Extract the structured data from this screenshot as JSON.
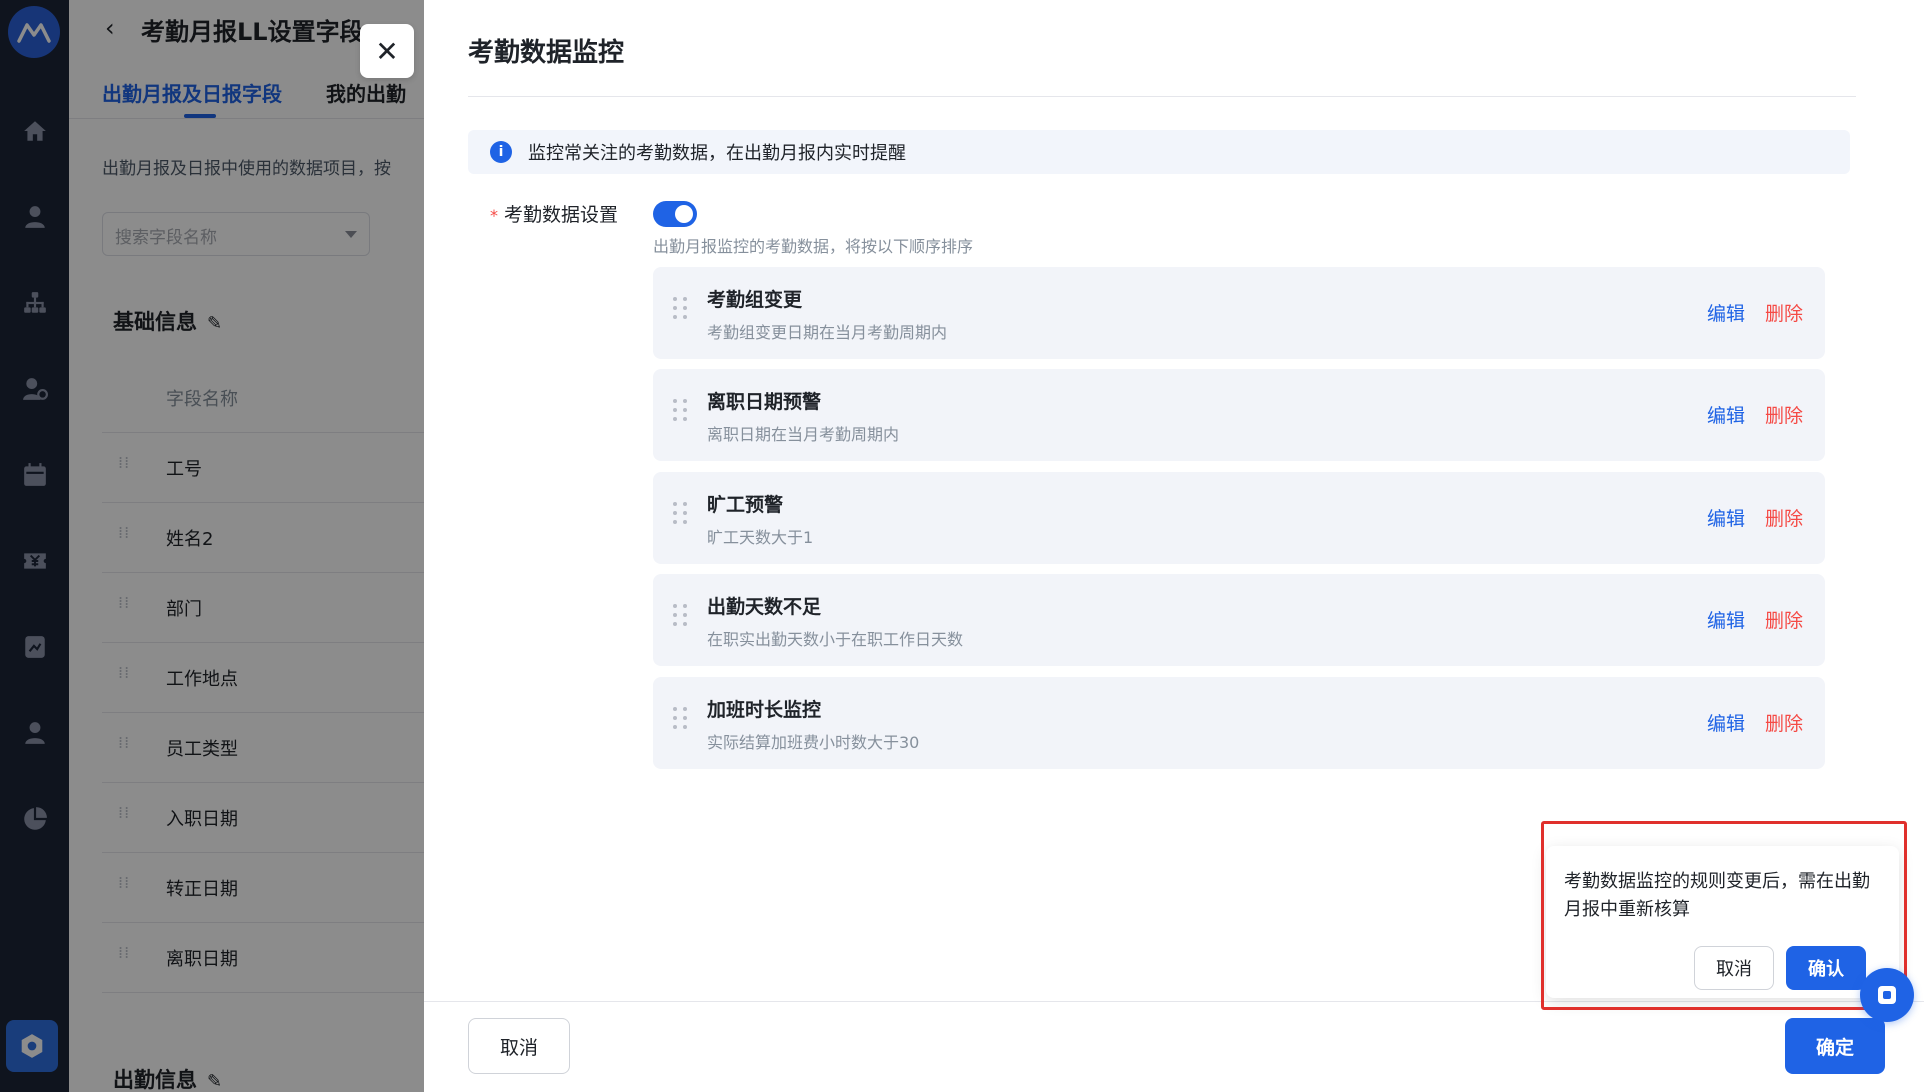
{
  "background_page": {
    "back_icon": "chevron-left-icon",
    "title": "考勤月报LL设置字段",
    "tabs": [
      {
        "label": "出勤月报及日报字段",
        "active": true
      },
      {
        "label": "我的出勤",
        "active": false
      }
    ],
    "description": "出勤月报及日报中使用的数据项目，按",
    "search_placeholder": "搜索字段名称",
    "section_basic": "基础信息",
    "column_header": "字段名称",
    "rows": [
      "工号",
      "姓名2",
      "部门",
      "工作地点",
      "员工类型",
      "入职日期",
      "转正日期",
      "离职日期"
    ],
    "section_attendance": "出勤信息"
  },
  "drawer": {
    "close_icon": "close-icon",
    "title": "考勤数据监控",
    "notice": "监控常关注的考勤数据，在出勤月报内实时提醒",
    "field_label": "考勤数据设置",
    "required_mark": "*",
    "toggle_on": true,
    "field_hint": "出勤月报监控的考勤数据，将按以下顺序排序",
    "rules": [
      {
        "title": "考勤组变更",
        "desc": "考勤组变更日期在当月考勤周期内",
        "edit": "编辑",
        "delete": "删除"
      },
      {
        "title": "离职日期预警",
        "desc": "离职日期在当月考勤周期内",
        "edit": "编辑",
        "delete": "删除"
      },
      {
        "title": "旷工预警",
        "desc": "旷工天数大于1",
        "edit": "编辑",
        "delete": "删除"
      },
      {
        "title": "出勤天数不足",
        "desc": "在职实出勤天数小于在职工作日天数",
        "edit": "编辑",
        "delete": "删除"
      },
      {
        "title": "加班时长监控",
        "desc": "实际结算加班费小时数大于30",
        "edit": "编辑",
        "delete": "删除"
      }
    ],
    "cancel_label": "取消",
    "confirm_label": "确定"
  },
  "popconfirm": {
    "message": "考勤数据监控的规则变更后，需在出勤月报中重新核算",
    "cancel_label": "取消",
    "ok_label": "确认"
  },
  "colors": {
    "primary": "#1f63e5",
    "danger": "#f54a45",
    "rail": "#1d2538",
    "highlight": "#e0302c"
  }
}
